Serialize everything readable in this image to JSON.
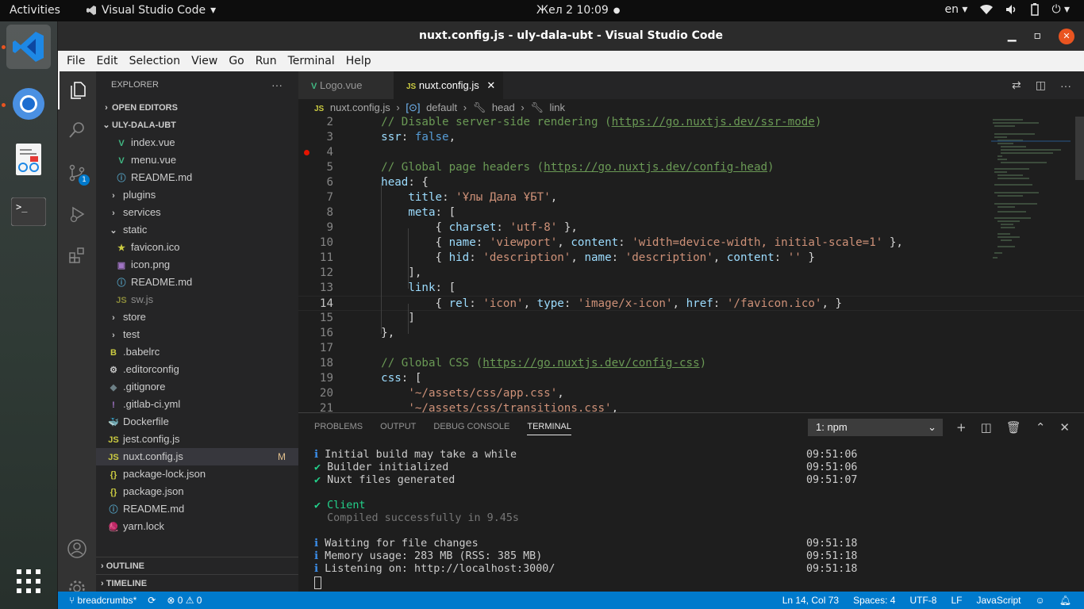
{
  "topbar": {
    "activities": "Activities",
    "app_name": "Visual Studio Code",
    "datetime": "Жел 2  10:09",
    "lang": "en",
    "tray_icons": [
      "wifi-icon",
      "volume-icon",
      "battery-icon",
      "power-icon"
    ]
  },
  "dock": {
    "apps": [
      "vscode",
      "chromium",
      "text-editor",
      "terminal"
    ],
    "show_apps": "show-apps"
  },
  "window": {
    "title": "nuxt.config.js - uly-dala-ubt - Visual Studio Code"
  },
  "menubar": [
    "File",
    "Edit",
    "Selection",
    "View",
    "Go",
    "Run",
    "Terminal",
    "Help"
  ],
  "activitybar": {
    "scm_badge": "1"
  },
  "sidebar": {
    "title": "EXPLORER",
    "more": "···",
    "open_editors": "OPEN EDITORS",
    "project": "ULY-DALA-UBT",
    "rows": [
      {
        "icon": "V",
        "label": "index.vue",
        "indent": 1,
        "type": "vue"
      },
      {
        "icon": "V",
        "label": "menu.vue",
        "indent": 1,
        "type": "vue"
      },
      {
        "icon": "ⓘ",
        "label": "README.md",
        "indent": 1,
        "type": "info"
      },
      {
        "icon": "›",
        "label": "plugins",
        "indent": 0,
        "type": "folder"
      },
      {
        "icon": "›",
        "label": "services",
        "indent": 0,
        "type": "folder"
      },
      {
        "icon": "⌄",
        "label": "static",
        "indent": 0,
        "type": "folder"
      },
      {
        "icon": "★",
        "label": "favicon.ico",
        "indent": 1,
        "type": "star"
      },
      {
        "icon": "▣",
        "label": "icon.png",
        "indent": 1,
        "type": "image"
      },
      {
        "icon": "ⓘ",
        "label": "README.md",
        "indent": 1,
        "type": "info"
      },
      {
        "icon": "JS",
        "label": "sw.js",
        "indent": 1,
        "type": "js-dim"
      },
      {
        "icon": "›",
        "label": "store",
        "indent": 0,
        "type": "folder"
      },
      {
        "icon": "›",
        "label": "test",
        "indent": 0,
        "type": "folder"
      },
      {
        "icon": "B",
        "label": ".babelrc",
        "indent": 0,
        "type": "babel"
      },
      {
        "icon": "⚙",
        "label": ".editorconfig",
        "indent": 0,
        "type": "gear"
      },
      {
        "icon": "◆",
        "label": ".gitignore",
        "indent": 0,
        "type": "git"
      },
      {
        "icon": "!",
        "label": ".gitlab-ci.yml",
        "indent": 0,
        "type": "yml"
      },
      {
        "icon": "🐳",
        "label": "Dockerfile",
        "indent": 0,
        "type": "docker"
      },
      {
        "icon": "JS",
        "label": "jest.config.js",
        "indent": 0,
        "type": "js"
      },
      {
        "icon": "JS",
        "label": "nuxt.config.js",
        "indent": 0,
        "type": "js",
        "selected": true,
        "modified": "M"
      },
      {
        "icon": "{}",
        "label": "package-lock.json",
        "indent": 0,
        "type": "json"
      },
      {
        "icon": "{}",
        "label": "package.json",
        "indent": 0,
        "type": "json"
      },
      {
        "icon": "ⓘ",
        "label": "README.md",
        "indent": 0,
        "type": "info"
      },
      {
        "icon": "🧶",
        "label": "yarn.lock",
        "indent": 0,
        "type": "yarn"
      }
    ],
    "outline": "OUTLINE",
    "timeline": "TIMELINE"
  },
  "tabs": [
    {
      "label": "Logo.vue",
      "active": false
    },
    {
      "label": "nuxt.config.js",
      "active": true
    }
  ],
  "breadcrumb": [
    "nuxt.config.js",
    "default",
    "head",
    "link"
  ],
  "code": {
    "lines": [
      {
        "n": "2",
        "html": "    <span class=\"c-com\">// Disable server-side rendering (</span><span class=\"c-link\">https://go.nuxtjs.dev/ssr-mode</span><span class=\"c-com\">)</span>"
      },
      {
        "n": "3",
        "html": "    <span class=\"c-key\">ssr</span>: <span class=\"c-kw\">false</span>,"
      },
      {
        "n": "4",
        "html": "",
        "bp": true
      },
      {
        "n": "5",
        "html": "    <span class=\"c-com\">// Global page headers (</span><span class=\"c-link\">https://go.nuxtjs.dev/config-head</span><span class=\"c-com\">)</span>"
      },
      {
        "n": "6",
        "html": "    <span class=\"c-key\">head</span>: {"
      },
      {
        "n": "7",
        "html": "        <span class=\"c-key\">title</span>: <span class=\"c-str\">'Ұлы Дала ҰБТ'</span>,"
      },
      {
        "n": "8",
        "html": "        <span class=\"c-key\">meta</span>: ["
      },
      {
        "n": "9",
        "html": "            { <span class=\"c-key\">charset</span>: <span class=\"c-str\">'utf-8'</span> },"
      },
      {
        "n": "10",
        "html": "            { <span class=\"c-key\">name</span>: <span class=\"c-str\">'viewport'</span>, <span class=\"c-key\">content</span>: <span class=\"c-str\">'width=device-width, initial-scale=1'</span> },"
      },
      {
        "n": "11",
        "html": "            { <span class=\"c-key\">hid</span>: <span class=\"c-str\">'description'</span>, <span class=\"c-key\">name</span>: <span class=\"c-str\">'description'</span>, <span class=\"c-key\">content</span>: <span class=\"c-str\">''</span> }"
      },
      {
        "n": "12",
        "html": "        ],"
      },
      {
        "n": "13",
        "html": "        <span class=\"c-key\">link</span>: ["
      },
      {
        "n": "14",
        "html": "            { <span class=\"c-key\">rel</span>: <span class=\"c-str\">'icon'</span>, <span class=\"c-key\">type</span>: <span class=\"c-str\">'image/x-icon'</span>, <span class=\"c-key\">href</span>: <span class=\"c-str\">'/favicon.ico'</span>, }",
        "current": true
      },
      {
        "n": "15",
        "html": "        ]"
      },
      {
        "n": "16",
        "html": "    },"
      },
      {
        "n": "17",
        "html": ""
      },
      {
        "n": "18",
        "html": "    <span class=\"c-com\">// Global CSS (</span><span class=\"c-link\">https://go.nuxtjs.dev/config-css</span><span class=\"c-com\">)</span>"
      },
      {
        "n": "19",
        "html": "    <span class=\"c-key\">css</span>: ["
      },
      {
        "n": "20",
        "html": "        <span class=\"c-str\">'~/assets/css/app.css'</span>,"
      },
      {
        "n": "21",
        "html": "        <span class=\"c-str\">'~/assets/css/transitions.css'</span>,"
      }
    ]
  },
  "panel": {
    "tabs": [
      "PROBLEMS",
      "OUTPUT",
      "DEBUG CONSOLE",
      "TERMINAL"
    ],
    "active_tab": "TERMINAL",
    "terminal_select": "1: npm",
    "lines": [
      {
        "icon": "ℹ",
        "cls": "t-info",
        "text": "Initial build may take a while",
        "time": "09:51:06"
      },
      {
        "icon": "✔",
        "cls": "t-ok",
        "text": "Builder initialized",
        "time": "09:51:06"
      },
      {
        "icon": "✔",
        "cls": "t-ok",
        "text": "Nuxt files generated",
        "time": "09:51:07"
      },
      {
        "icon": "",
        "cls": "",
        "text": "",
        "time": ""
      },
      {
        "icon": "✔",
        "cls": "t-ok",
        "text": "Client",
        "time": "",
        "textcls": "t-ok"
      },
      {
        "icon": "",
        "cls": "",
        "text": "Compiled successfully in 9.45s",
        "time": "",
        "textcls": "t-dim"
      },
      {
        "icon": "",
        "cls": "",
        "text": "",
        "time": ""
      },
      {
        "icon": "ℹ",
        "cls": "t-info",
        "text": "Waiting for file changes",
        "time": "09:51:18"
      },
      {
        "icon": "ℹ",
        "cls": "t-info",
        "text": "Memory usage: 283 MB (RSS: 385 MB)",
        "time": "09:51:18"
      },
      {
        "icon": "ℹ",
        "cls": "t-info",
        "text": "Listening on: http://localhost:3000/",
        "time": "09:51:18"
      }
    ]
  },
  "statusbar": {
    "branch": "breadcrumbs*",
    "sync": "⟳",
    "problems": "⊗ 0 ⚠ 0",
    "position": "Ln 14, Col 73",
    "spaces": "Spaces: 4",
    "encoding": "UTF-8",
    "eol": "LF",
    "language": "JavaScript"
  },
  "colors": {
    "accent": "#007acc",
    "ubuntu_orange": "#e95420"
  }
}
